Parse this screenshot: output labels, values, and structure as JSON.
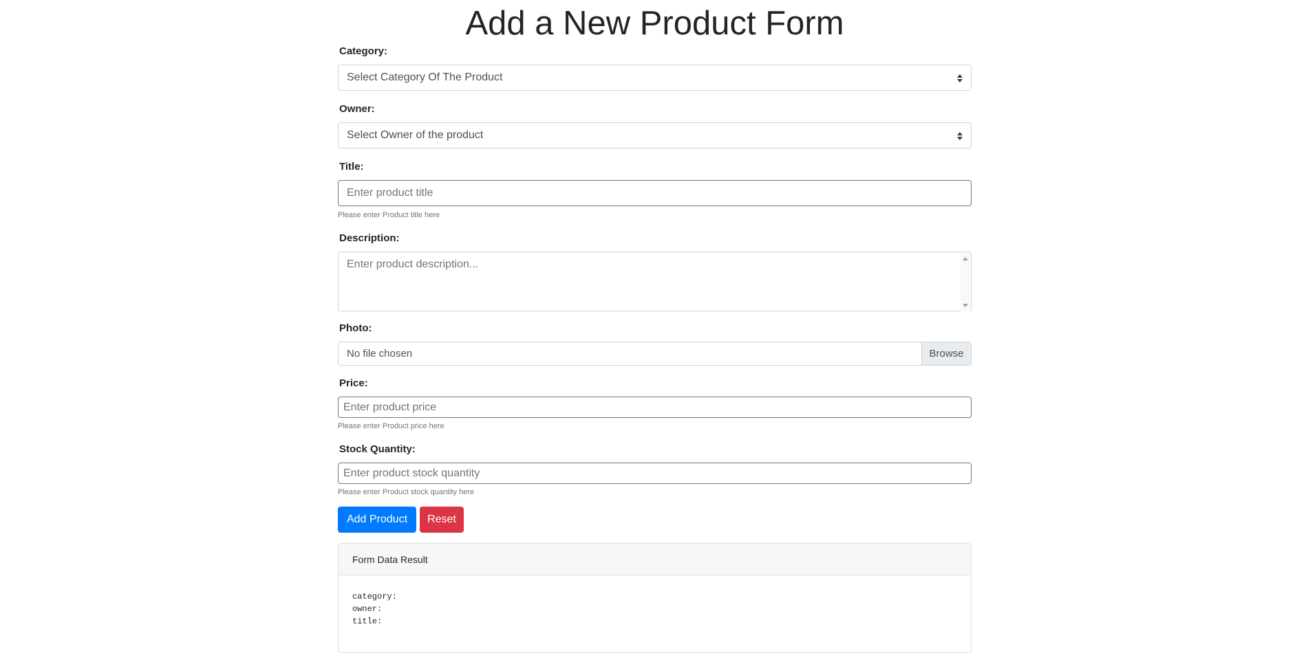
{
  "page": {
    "title": "Add a New Product Form"
  },
  "form": {
    "category": {
      "label": "Category:",
      "selected": "Select Category Of The Product"
    },
    "owner": {
      "label": "Owner:",
      "selected": "Select Owner of the product"
    },
    "title": {
      "label": "Title:",
      "placeholder": "Enter product title",
      "value": "",
      "help": "Please enter Product title here"
    },
    "description": {
      "label": "Description:",
      "placeholder": "Enter product description...",
      "value": ""
    },
    "photo": {
      "label": "Photo:",
      "status": "No file chosen",
      "browse_label": "Browse"
    },
    "price": {
      "label": "Price:",
      "placeholder": "Enter product price",
      "value": "",
      "help": "Please enter Product price here"
    },
    "stock": {
      "label": "Stock Quantity:",
      "placeholder": "Enter product stock quantity",
      "value": "",
      "help": "Please enter Product stock quantity here"
    },
    "buttons": {
      "submit_label": "Add Product",
      "reset_label": "Reset"
    }
  },
  "result_card": {
    "header": "Form Data Result",
    "lines": [
      "category:",
      "owner:",
      "title:"
    ]
  },
  "colors": {
    "primary": "#007bff",
    "danger": "#dc3545",
    "text": "#212529",
    "muted": "#6c757d"
  }
}
